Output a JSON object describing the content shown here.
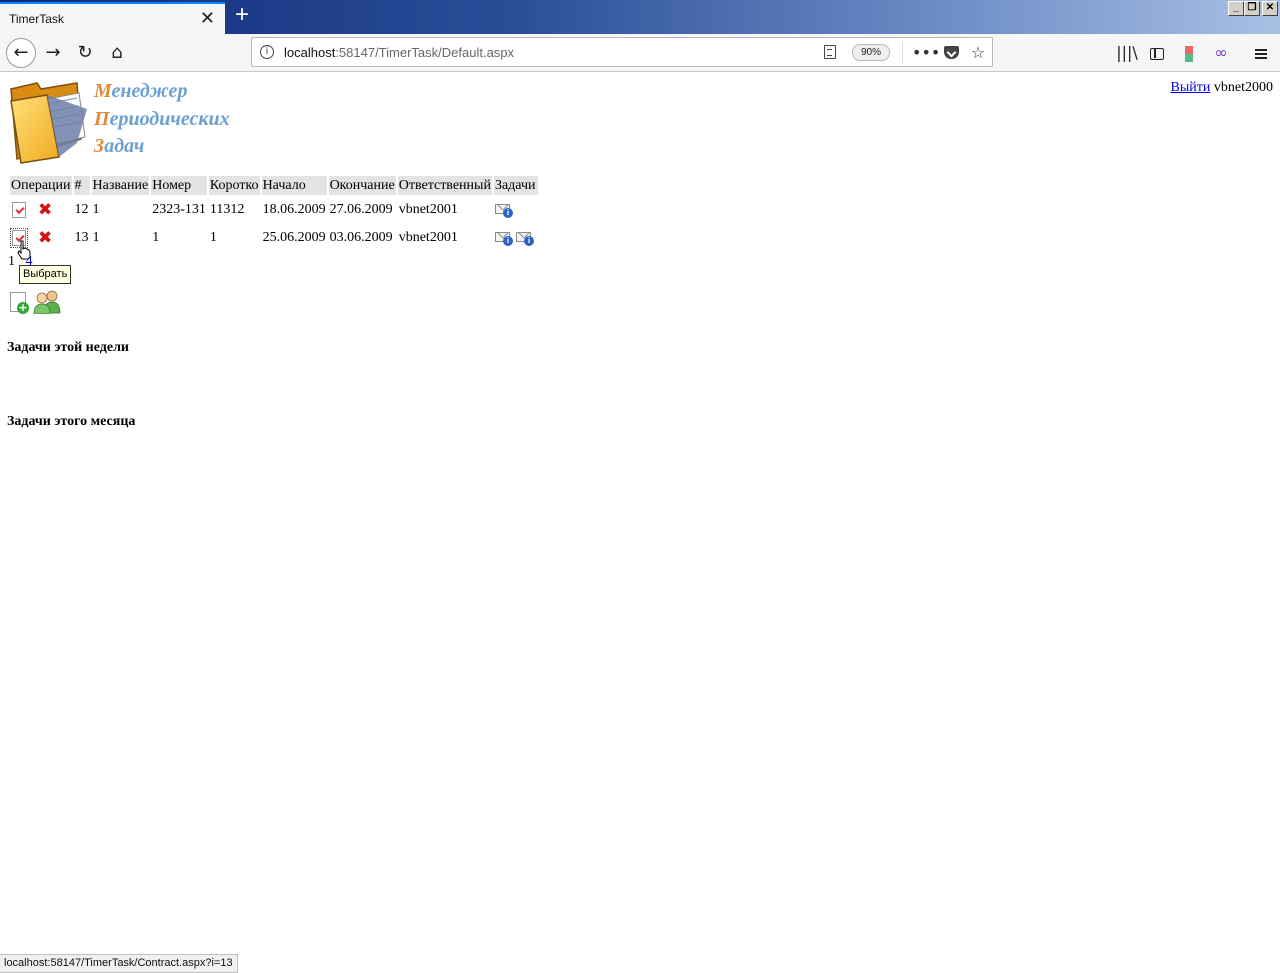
{
  "browser": {
    "tab_title": "TimerTask",
    "url_host": "localhost",
    "url_rest": ":58147/TimerTask/Default.aspx",
    "zoom": "90%",
    "status_url": "localhost:58147/TimerTask/Contract.aspx?i=13"
  },
  "header": {
    "logo_lines": [
      {
        "first": "М",
        "rest": "енеджер"
      },
      {
        "first": "П",
        "rest": "ериодических"
      },
      {
        "first": "З",
        "rest": "адач"
      }
    ],
    "logout_label": "Выйти",
    "username": "vbnet2000"
  },
  "table": {
    "columns": [
      "Операции",
      "#",
      "Название",
      "Номер",
      "Коротко",
      "Начало",
      "Окончание",
      "Ответственный",
      "Задачи"
    ],
    "rows": [
      {
        "id": "12",
        "name": "1",
        "number": "2323-131",
        "short": "11312",
        "start": "18.06.2009",
        "end": "27.06.2009",
        "owner": "vbnet2001",
        "task_icons": 1
      },
      {
        "id": "13",
        "name": "1",
        "number": "1",
        "short": "1",
        "start": "25.06.2009",
        "end": "03.06.2009",
        "owner": "vbnet2001",
        "task_icons": 2
      }
    ]
  },
  "pager": {
    "current": "1",
    "link_partial": "4"
  },
  "tooltip": "Выбрать",
  "sections": {
    "week_title": "Задачи этой недели",
    "month_title": "Задачи этого месяца"
  },
  "icons": {
    "select": "document-check-icon",
    "delete": "delete-x-icon",
    "task": "mail-info-icon",
    "add": "add-document-icon",
    "users": "users-icon"
  },
  "colors": {
    "logo_blue": "#6a9fd3",
    "logo_orange": "#e08a3a",
    "link": "#0000ee",
    "delete": "#d21414",
    "header_bg": "#e3e3e3"
  }
}
